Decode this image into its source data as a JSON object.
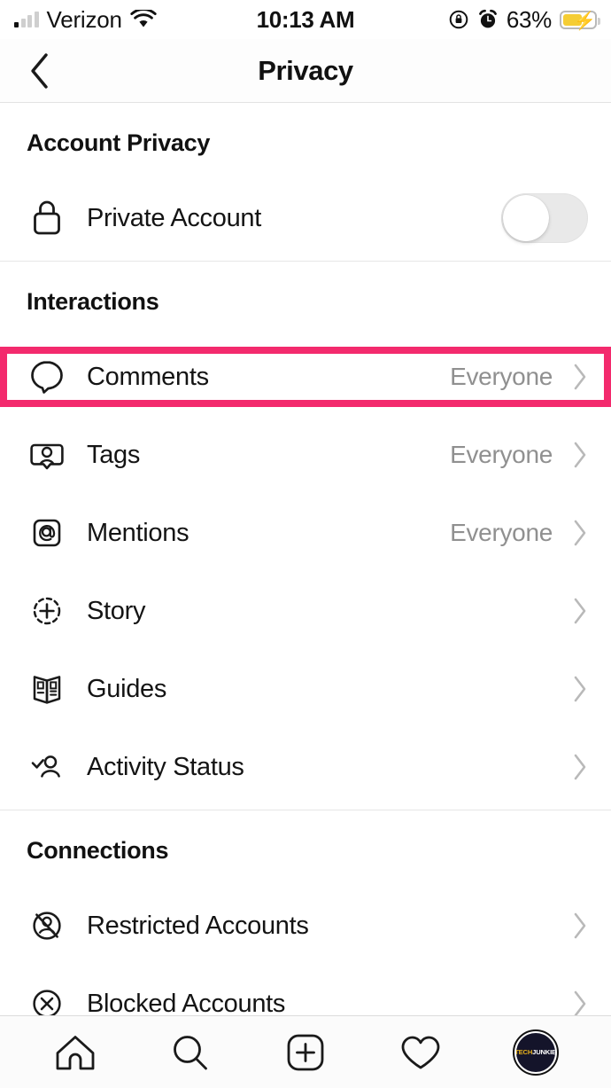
{
  "status_bar": {
    "carrier": "Verizon",
    "signal_icon": "signal-bars-icon",
    "wifi_icon": "wifi-icon",
    "time": "10:13 AM",
    "rotation_lock_icon": "rotation-lock-icon",
    "alarm_icon": "alarm-clock-icon",
    "battery_percent": "63%",
    "battery_level": 63,
    "battery_charging": true,
    "battery_color": "#f5cd34"
  },
  "nav": {
    "back_icon": "chevron-left-icon",
    "title": "Privacy"
  },
  "highlight_color": "#f32a6d",
  "sections": [
    {
      "header": "Account Privacy",
      "rows": [
        {
          "icon": "lock-icon",
          "label": "Private Account",
          "control": "toggle",
          "toggle_on": false
        }
      ]
    },
    {
      "header": "Interactions",
      "rows": [
        {
          "icon": "comment-bubble-icon",
          "label": "Comments",
          "value": "Everyone",
          "highlighted": true
        },
        {
          "icon": "tag-person-icon",
          "label": "Tags",
          "value": "Everyone"
        },
        {
          "icon": "mention-at-icon",
          "label": "Mentions",
          "value": "Everyone"
        },
        {
          "icon": "story-plus-icon",
          "label": "Story",
          "value": ""
        },
        {
          "icon": "guides-book-icon",
          "label": "Guides",
          "value": ""
        },
        {
          "icon": "activity-status-icon",
          "label": "Activity Status",
          "value": ""
        }
      ]
    },
    {
      "header": "Connections",
      "rows": [
        {
          "icon": "restricted-account-icon",
          "label": "Restricted Accounts",
          "value": ""
        },
        {
          "icon": "blocked-account-icon",
          "label": "Blocked Accounts",
          "value": ""
        }
      ]
    }
  ],
  "tabbar": {
    "items": [
      {
        "icon": "home-icon",
        "name": "tab-home"
      },
      {
        "icon": "search-icon",
        "name": "tab-search"
      },
      {
        "icon": "add-post-icon",
        "name": "tab-add"
      },
      {
        "icon": "heart-icon",
        "name": "tab-activity"
      },
      {
        "icon": "profile-avatar",
        "name": "tab-profile"
      }
    ],
    "avatar_text_1": "TECH",
    "avatar_text_2": "JUNKIE"
  }
}
